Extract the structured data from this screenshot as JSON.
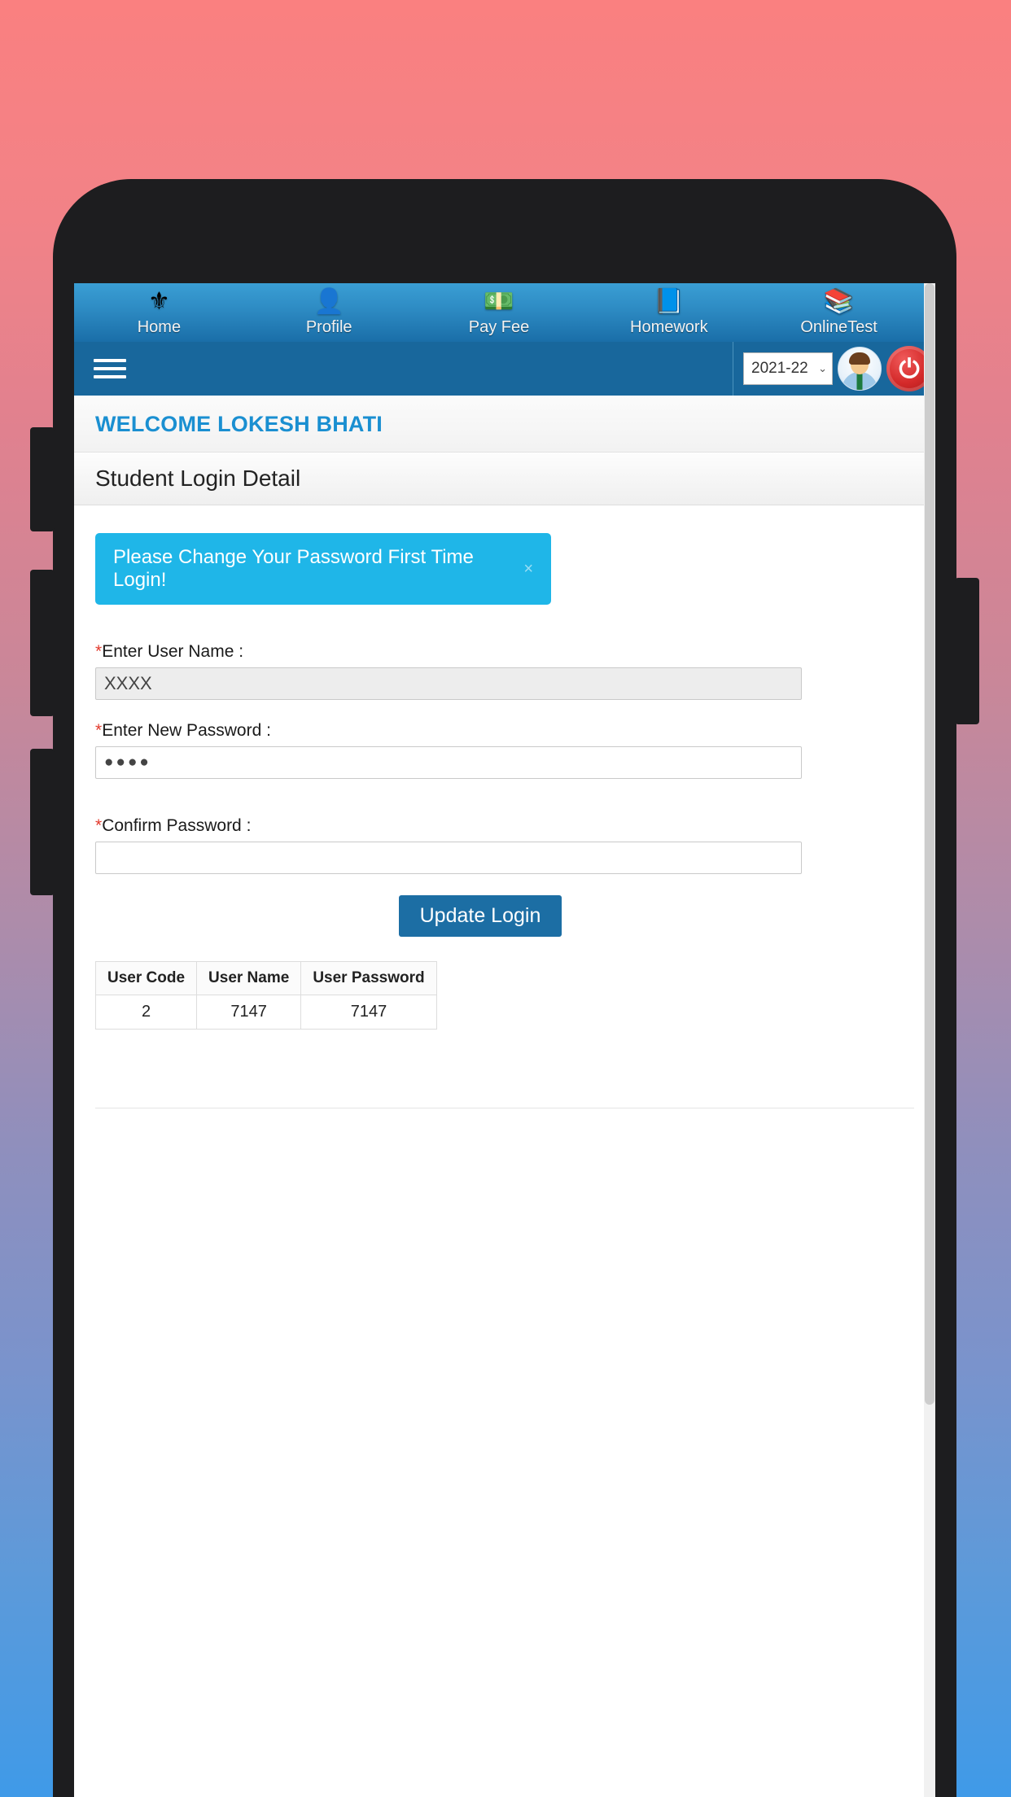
{
  "device": {
    "frame_color": "#1d1d1f",
    "background_gradient_top": "#fa8080",
    "background_gradient_bottom": "#3f9ae8"
  },
  "top_nav": {
    "items": [
      {
        "label": "Home",
        "icon": "emblem-icon",
        "glyph": "⚜"
      },
      {
        "label": "Profile",
        "icon": "person-icon",
        "glyph": "👤"
      },
      {
        "label": "Pay Fee",
        "icon": "money-icon",
        "glyph": "💵"
      },
      {
        "label": "Homework",
        "icon": "books-icon",
        "glyph": "📘"
      },
      {
        "label": "OnlineTest",
        "icon": "bookstack-icon",
        "glyph": "📚"
      }
    ]
  },
  "sub_bar": {
    "menu_icon": "hamburger-icon",
    "session_year": "2021-22",
    "session_options": [
      "2021-22"
    ],
    "caret": "⌄",
    "avatar_icon": "user-avatar-icon",
    "logout_icon": "power-icon",
    "logout_glyph": "⏻"
  },
  "content": {
    "welcome": "WELCOME LOKESH BHATI",
    "panel_title": "Student Login Detail",
    "alert": {
      "message": "Please Change Your Password First Time Login!",
      "close_label": "×",
      "color": "#1fb6e8"
    },
    "form": {
      "username": {
        "required_marker": "*",
        "label": "Enter User Name :",
        "value": "XXXX",
        "placeholder": ""
      },
      "new_password": {
        "required_marker": "*",
        "label": "Enter New Password :",
        "value": "●●●●",
        "placeholder": ""
      },
      "confirm_password": {
        "required_marker": "*",
        "label": "Confirm Password :",
        "value": "",
        "placeholder": ""
      },
      "submit_label": "Update Login"
    },
    "table": {
      "columns": [
        "User Code",
        "User Name",
        "User Password"
      ],
      "rows": [
        [
          "2",
          "7147",
          "7147"
        ]
      ]
    }
  }
}
